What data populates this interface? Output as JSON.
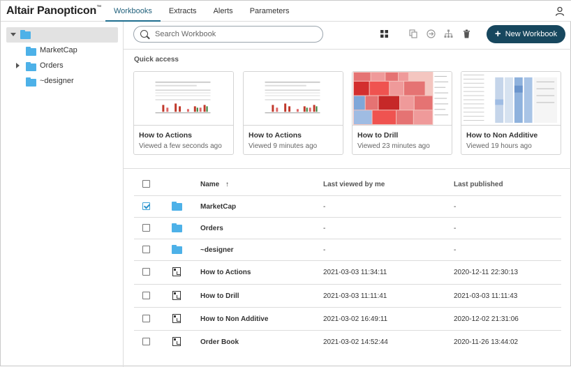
{
  "app": {
    "title": "Altair Panopticon",
    "title_mark": "™"
  },
  "tabs": [
    {
      "label": "Workbooks",
      "active": true
    },
    {
      "label": "Extracts",
      "active": false
    },
    {
      "label": "Alerts",
      "active": false
    },
    {
      "label": "Parameters",
      "active": false
    }
  ],
  "sidebar": {
    "root": {
      "label": "",
      "expanded": true,
      "selected": true
    },
    "items": [
      {
        "label": "MarketCap",
        "expandable": false
      },
      {
        "label": "Orders",
        "expandable": true
      },
      {
        "label": "~designer",
        "expandable": false
      }
    ]
  },
  "toolbar": {
    "search_placeholder": "Search Workbook",
    "icons": [
      "grid-view-icon",
      "copy-icon",
      "move-icon",
      "hierarchy-icon",
      "trash-icon"
    ],
    "new_button_label": "New Workbook"
  },
  "quick_access": {
    "title": "Quick access",
    "cards": [
      {
        "title": "How to Actions",
        "subtitle": "Viewed a few seconds ago",
        "thumb": "small-chart"
      },
      {
        "title": "How to Actions",
        "subtitle": "Viewed 9 minutes ago",
        "thumb": "small-chart"
      },
      {
        "title": "How to Drill",
        "subtitle": "Viewed 23 minutes ago",
        "thumb": "treemap"
      },
      {
        "title": "How to Non Additive",
        "subtitle": "Viewed 19 hours ago",
        "thumb": "table-heat"
      }
    ]
  },
  "table": {
    "headers": {
      "name": "Name",
      "sort_arrow": "↑",
      "last_viewed": "Last viewed by me",
      "last_published": "Last published"
    },
    "rows": [
      {
        "type": "folder",
        "name": "MarketCap",
        "last_viewed": "-",
        "last_published": "-",
        "checked": true
      },
      {
        "type": "folder",
        "name": "Orders",
        "last_viewed": "-",
        "last_published": "-",
        "checked": false
      },
      {
        "type": "folder",
        "name": "~designer",
        "last_viewed": "-",
        "last_published": "-",
        "checked": false
      },
      {
        "type": "workbook",
        "name": "How to Actions",
        "last_viewed": "2021-03-03 11:34:11",
        "last_published": "2020-12-11 22:30:13",
        "checked": false
      },
      {
        "type": "workbook",
        "name": "How to Drill",
        "last_viewed": "2021-03-03 11:11:41",
        "last_published": "2021-03-03 11:11:43",
        "checked": false
      },
      {
        "type": "workbook",
        "name": "How to Non Additive",
        "last_viewed": "2021-03-02 16:49:11",
        "last_published": "2020-12-02 21:31:06",
        "checked": false
      },
      {
        "type": "workbook",
        "name": "Order Book",
        "last_viewed": "2021-03-02 14:52:44",
        "last_published": "2020-11-26 13:44:02",
        "checked": false
      }
    ]
  },
  "colors": {
    "accent": "#1f6f8f",
    "button": "#17475e",
    "folder": "#4db1e8",
    "check": "#2b93cc"
  }
}
